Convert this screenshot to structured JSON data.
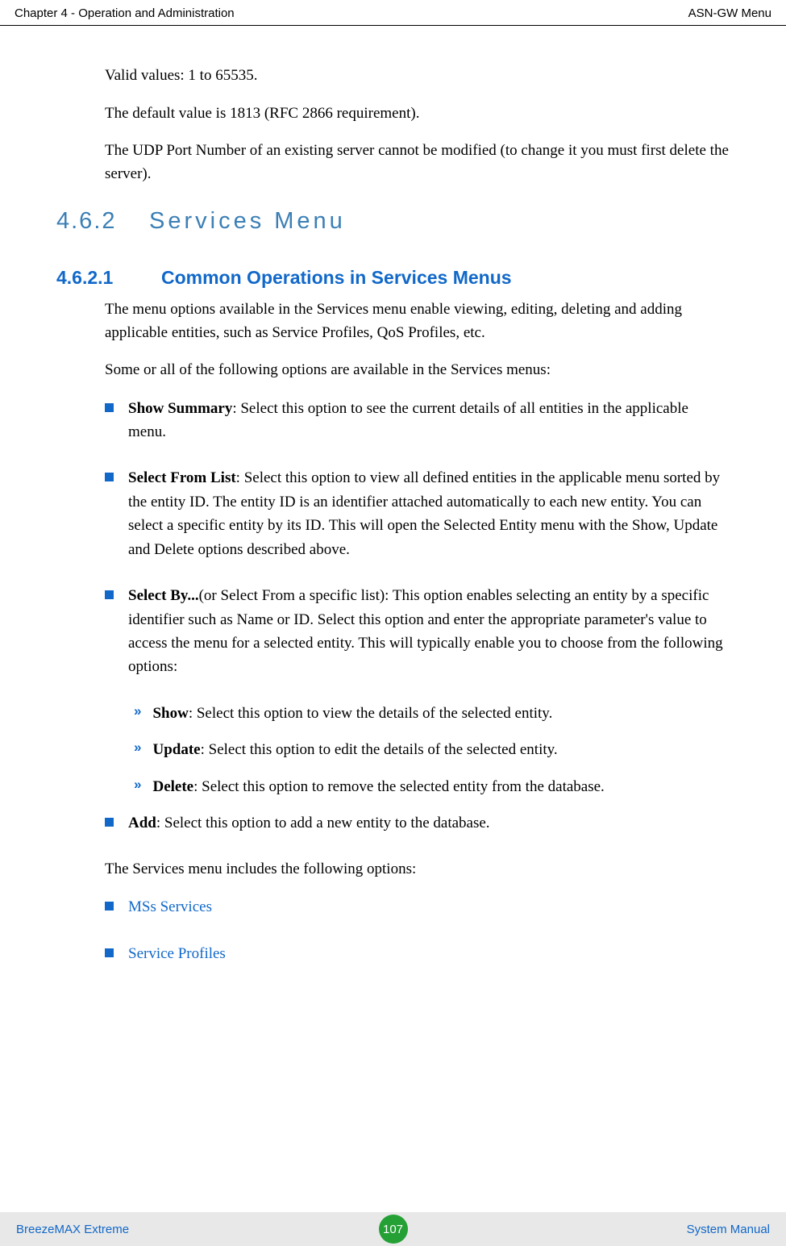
{
  "header": {
    "left": "Chapter 4 - Operation and Administration",
    "right": "ASN-GW Menu"
  },
  "intro": {
    "p1": "Valid values: 1 to 65535.",
    "p2": "The default value is 1813 (RFC 2866 requirement).",
    "p3": "The UDP Port Number of an existing server cannot be modified (to change it you must first delete the server)."
  },
  "section": {
    "number": "4.6.2",
    "title": "Services Menu"
  },
  "subsection": {
    "number": "4.6.2.1",
    "title": "Common Operations in Services Menus",
    "p1": "The menu options available in the Services menu enable viewing, editing, deleting and adding applicable entities, such as Service Profiles, QoS Profiles, etc.",
    "p2": "Some or all of the following options are available in the Services menus:"
  },
  "bullets": {
    "showSummary": {
      "label": "Show Summary",
      "text": ": Select this option to see the current details of all entities in the applicable menu."
    },
    "selectFromList": {
      "label": "Select From List",
      "text": ": Select this option to view all defined entities in the applicable menu sorted by the entity ID. The entity ID is an identifier attached automatically to each new entity. You can select a specific entity by its ID. This will open the Selected Entity menu with the Show, Update and Delete options described above."
    },
    "selectBy": {
      "label": "Select By...",
      "text": "(or Select From a specific list): This option enables selecting an entity by a specific identifier such as Name or ID. Select this option and enter the appropriate parameter's value to access the menu for a selected entity. This will typically enable you to choose from the following options:"
    },
    "sub": {
      "show": {
        "label": "Show",
        "text": ": Select this option to view the details of the selected entity."
      },
      "update": {
        "label": "Update",
        "text": ": Select this option to edit the details of the selected entity."
      },
      "delete": {
        "label": "Delete",
        "text": ": Select this option to remove the selected entity from the database."
      }
    },
    "add": {
      "label": "Add",
      "text": ": Select this option to add a new entity to the database."
    }
  },
  "outro": {
    "p1": "The Services menu includes the following options:"
  },
  "links": {
    "mss": "MSs Services",
    "serviceProfiles": "Service Profiles"
  },
  "footer": {
    "left": "BreezeMAX Extreme",
    "page": "107",
    "right": "System Manual"
  }
}
